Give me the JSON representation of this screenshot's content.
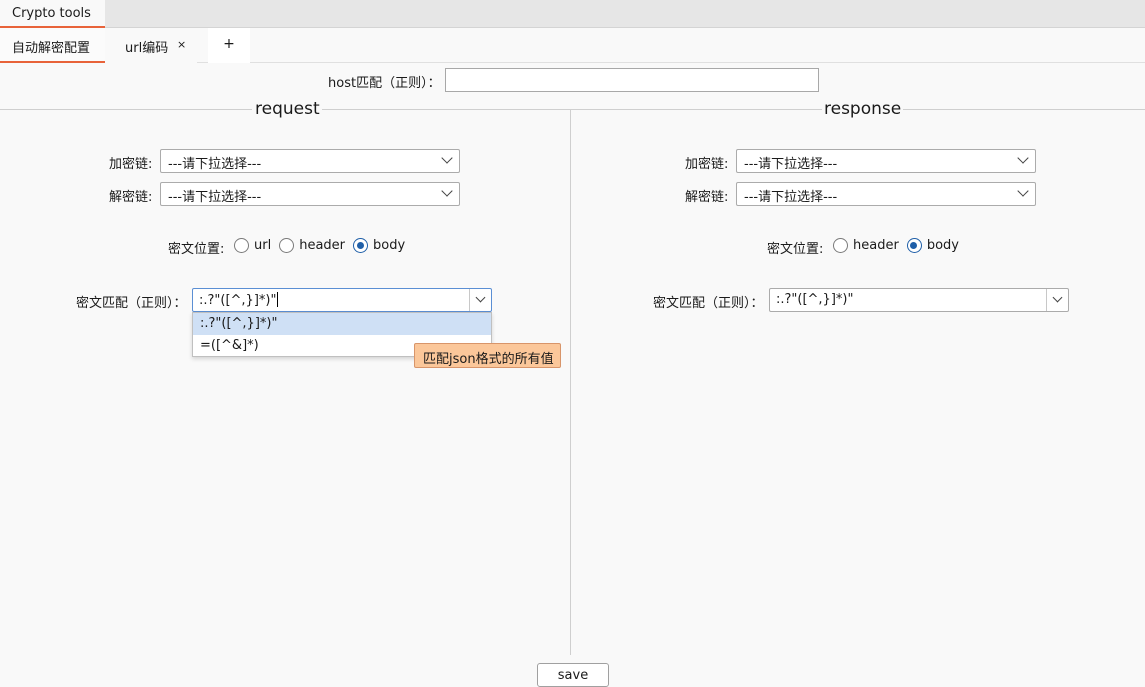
{
  "window": {
    "app_tab": "Crypto tools"
  },
  "tabs": [
    {
      "label": "自动解密配置"
    },
    {
      "label": "url编码",
      "close": "×"
    }
  ],
  "add_tab": "+",
  "host": {
    "label": "host匹配（正则）：",
    "value": ""
  },
  "request": {
    "title": "request",
    "encrypt_label": "加密链:",
    "encrypt_value": "---请下拉选择---",
    "decrypt_label": "解密链:",
    "decrypt_value": "---请下拉选择---",
    "position_label": "密文位置:",
    "positions": [
      "url",
      "header",
      "body"
    ],
    "selected_position": "body",
    "match_label": "密文匹配（正则）：",
    "match_value": ":.?\"([^,}]*)\"",
    "dropdown_options": [
      ":.?\"([^,}]*)\"",
      "=([^&]*)"
    ],
    "tooltip": "匹配json格式的所有值"
  },
  "response": {
    "title": "response",
    "encrypt_label": "加密链:",
    "encrypt_value": "---请下拉选择---",
    "decrypt_label": "解密链:",
    "decrypt_value": "---请下拉选择---",
    "position_label": "密文位置:",
    "positions": [
      "header",
      "body"
    ],
    "selected_position": "body",
    "match_label": "密文匹配（正则）：",
    "match_value": ":.?\"([^,}]*)\""
  },
  "save_label": "save",
  "colors": {
    "accent": "#e8633a",
    "radio": "#1f5fa8",
    "tooltip_bg": "#fbc79a",
    "selection": "#cfe0f5"
  }
}
